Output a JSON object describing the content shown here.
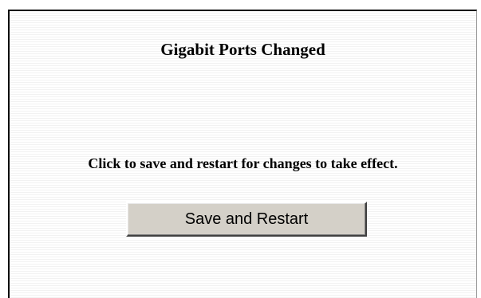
{
  "dialog": {
    "title": "Gigabit Ports Changed",
    "message": "Click to save and restart for changes to take effect.",
    "save_restart_label": "Save and Restart"
  }
}
